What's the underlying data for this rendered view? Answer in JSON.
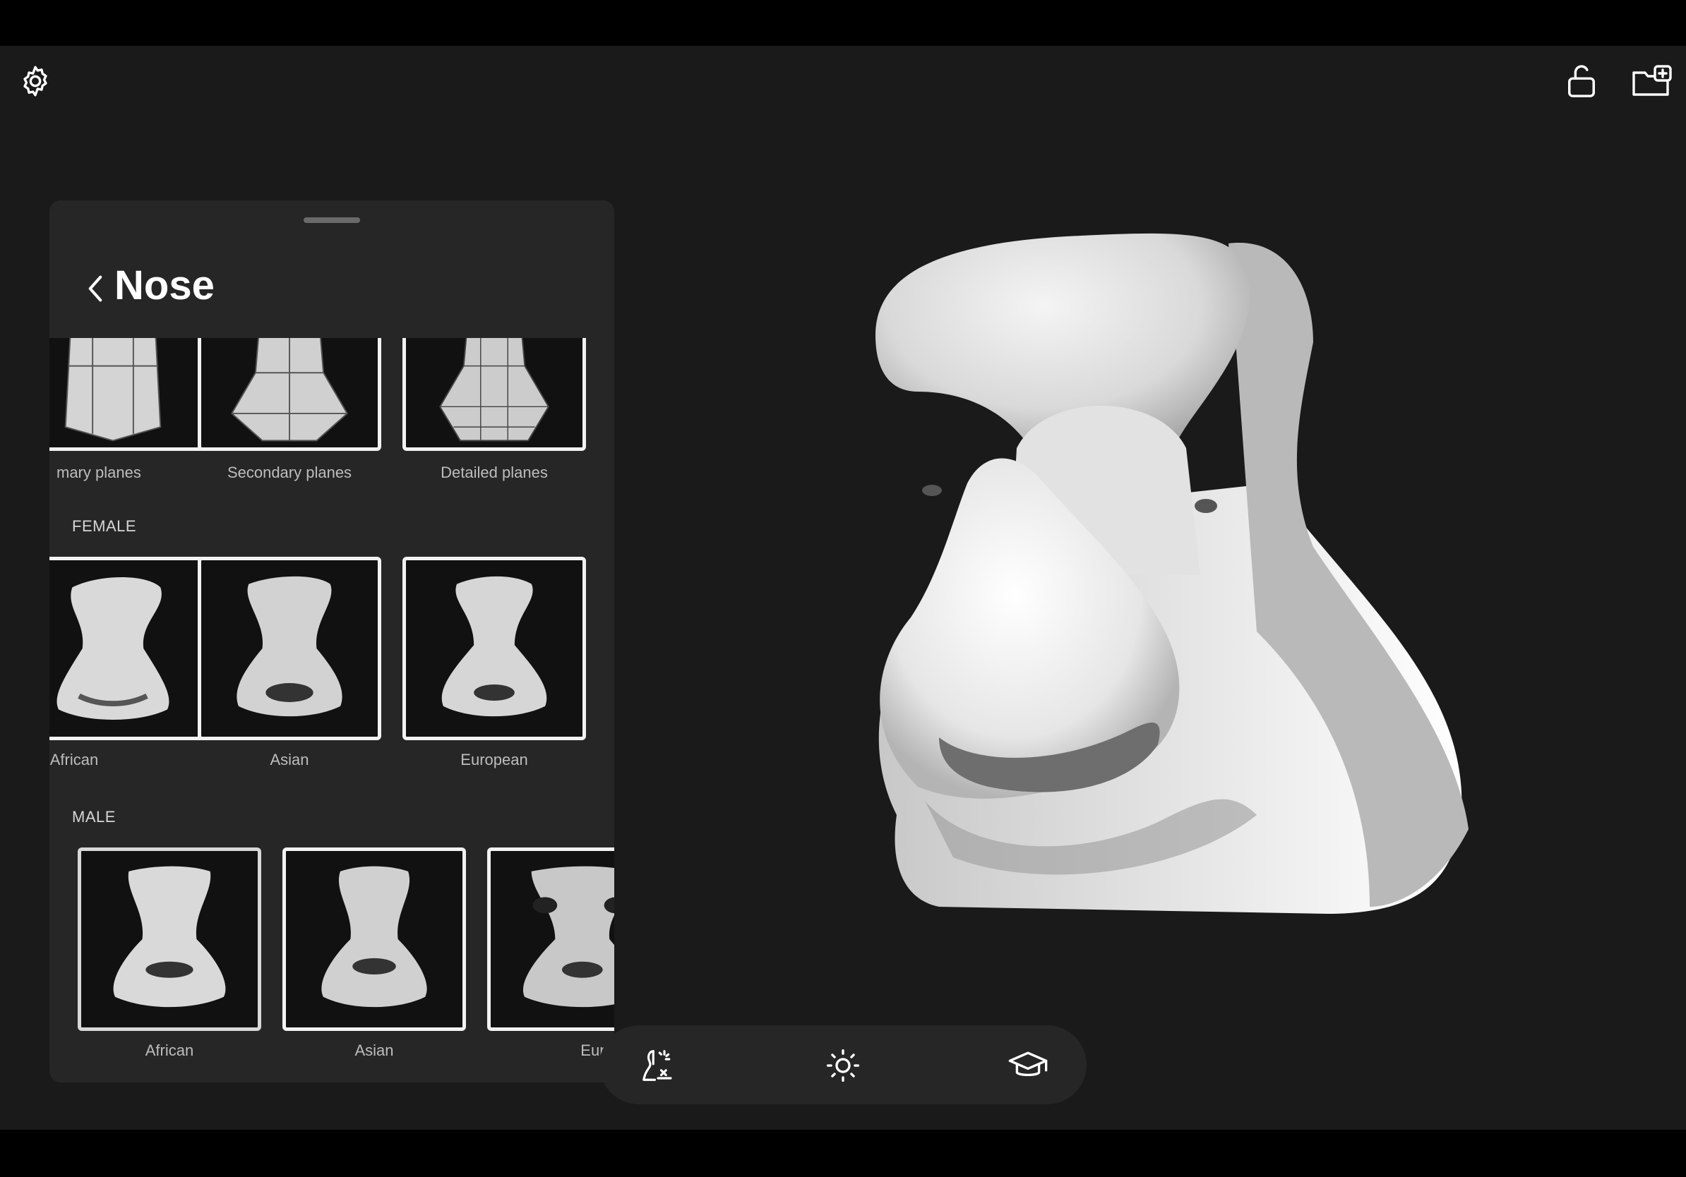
{
  "top_bar": {
    "settings_icon": "gear-icon",
    "lock_icon": "unlock-icon",
    "folder_icon": "folder-add-icon"
  },
  "panel": {
    "title": "Nose",
    "back_icon": "chevron-left-icon",
    "planes": [
      {
        "label": "mary planes",
        "kind": "primary"
      },
      {
        "label": "Secondary planes",
        "kind": "secondary"
      },
      {
        "label": "Detailed planes",
        "kind": "detailed"
      }
    ],
    "sections": [
      {
        "label": "FEMALE",
        "items": [
          {
            "label": "African"
          },
          {
            "label": "Asian"
          },
          {
            "label": "European"
          }
        ]
      },
      {
        "label": "MALE",
        "items": [
          {
            "label": "African"
          },
          {
            "label": "Asian"
          },
          {
            "label": "European"
          }
        ]
      }
    ]
  },
  "toolbar": {
    "items": [
      {
        "icon": "model-adjust-icon"
      },
      {
        "icon": "light-icon"
      },
      {
        "icon": "graduation-cap-icon"
      }
    ]
  },
  "colors": {
    "background": "#1a1a1a",
    "panel": "#262626",
    "frame": "#000000",
    "accent": "#ffffff"
  }
}
